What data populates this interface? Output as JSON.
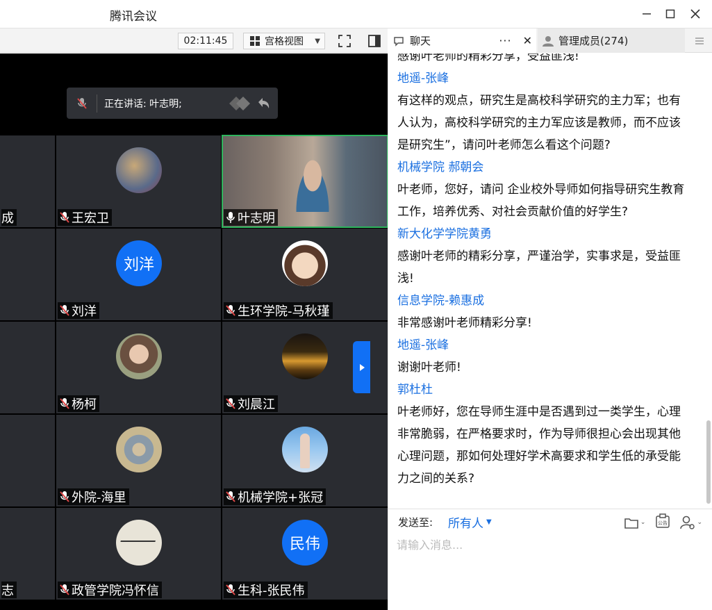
{
  "window": {
    "title": "腾讯会议"
  },
  "toolbar": {
    "timer": "02:11:45",
    "view_mode": "宫格视图"
  },
  "tabs": {
    "chat": "聊天",
    "members": "管理成员(274)"
  },
  "speaking": {
    "label": "正在讲话: 叶志明;"
  },
  "tiles": {
    "r1c0": "成",
    "r1c1": "王宏卫",
    "r1c2": "叶志明",
    "r2c1": "刘洋",
    "r2c2": "生环学院-马秋瑾",
    "r3c1": "杨柯",
    "r3c2": "刘晨江",
    "r4c1": "外院-海里",
    "r4c2": "机械学院+张冠",
    "r5c0": "志",
    "r5c1": "政管学院冯怀信",
    "r5c2": "生科-张民伟"
  },
  "avatars": {
    "liuyang": "刘洋",
    "minwei": "民伟"
  },
  "chat": {
    "messages": [
      {
        "sender": "",
        "lines": [
          "感谢叶老师的精彩分享，受益匪浅!"
        ]
      },
      {
        "sender": "地遥-张峰",
        "lines": [
          "有这样的观点，研究生是高校科学研究的主力军；也有",
          "人认为，高校科学研究的主力军应该是教师，而不应该",
          "是研究生”，请问叶老师怎么看这个问题?"
        ]
      },
      {
        "sender": "机械学院 郝朝会",
        "lines": [
          "叶老师，您好，请问 企业校外导师如何指导研究生教育",
          "工作，培养优秀、对社会贡献价值的好学生?"
        ]
      },
      {
        "sender": "新大化学学院黄勇",
        "lines": [
          "感谢叶老师的精彩分享，严谨治学，实事求是，受益匪",
          "浅!"
        ]
      },
      {
        "sender": "信息学院-赖惠成",
        "lines": [
          "非常感谢叶老师精彩分享!"
        ]
      },
      {
        "sender": "地遥-张峰",
        "lines": [
          "谢谢叶老师!"
        ]
      },
      {
        "sender": "郭杜杜",
        "lines": [
          "叶老师好，您在导师生涯中是否遇到过一类学生，心理",
          "非常脆弱，在严格要求时，作为导师很担心会出现其他",
          "心理问题，那如何处理好学术高要求和学生低的承受能",
          "力之间的关系?"
        ]
      }
    ]
  },
  "compose": {
    "send_to_label": "发送至:",
    "send_to_value": "所有人",
    "placeholder": "请输入消息...",
    "notice_icon_text": "公告"
  },
  "colors": {
    "accent": "#1170f5",
    "link": "#1a6fe0",
    "tile_bg": "#2a2c31",
    "active_speaker": "#2db55d"
  }
}
